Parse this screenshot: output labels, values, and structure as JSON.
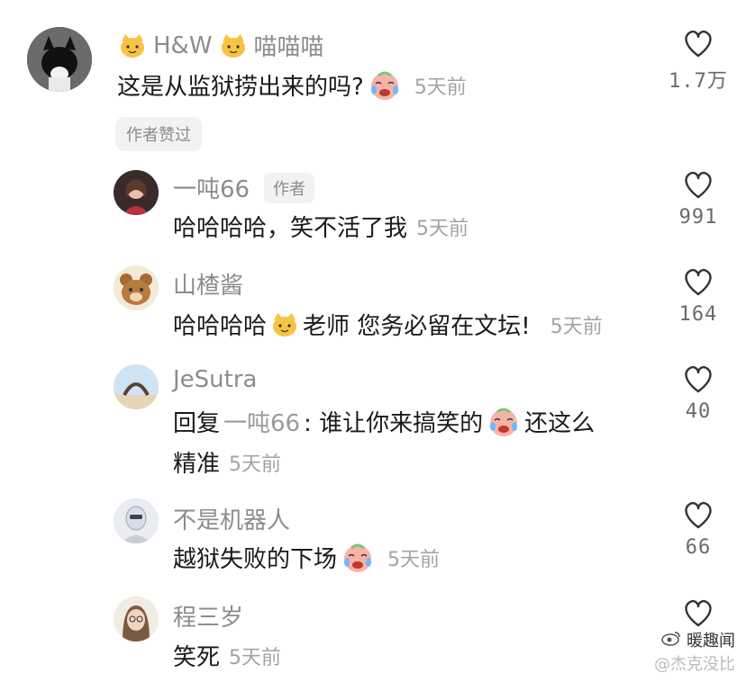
{
  "comments": [
    {
      "username": "H&W",
      "username_suffix": "喵喵喵",
      "text": "这是从监狱捞出来的吗?",
      "time": "5天前",
      "likes": "1.7万",
      "badge": "作者赞过",
      "avatar": "cat-avatar"
    },
    {
      "username": "一吨66",
      "author_tag": "作者",
      "text": "哈哈哈哈，笑不活了我",
      "time": "5天前",
      "likes": "991",
      "avatar": "girl-avatar"
    },
    {
      "username": "山楂酱",
      "text_before": "哈哈哈哈",
      "text_after": "老师 您务必留在文坛!",
      "time": "5天前",
      "likes": "164",
      "avatar": "bear-avatar"
    },
    {
      "username": "JeSutra",
      "reply_prefix": "回复",
      "reply_to": "一吨66",
      "text_main": ": 谁让你来搞笑的",
      "text_tail": "还这么",
      "text_line2": "精准",
      "time": "5天前",
      "likes": "40",
      "avatar": "yoga-avatar"
    },
    {
      "username": "不是机器人",
      "text": "越狱失败的下场",
      "time": "5天前",
      "likes": "66",
      "avatar": "robot-avatar"
    },
    {
      "username": "程三岁",
      "text": "笑死",
      "time": "5天前",
      "likes": "",
      "avatar": "woman-avatar"
    }
  ],
  "watermark": {
    "line1": "暖趣闻",
    "line2": "@杰克没比"
  },
  "colors": {
    "username": "#8c8c8c",
    "time": "#a3a3a3",
    "tag_bg": "#f2f2f2"
  }
}
